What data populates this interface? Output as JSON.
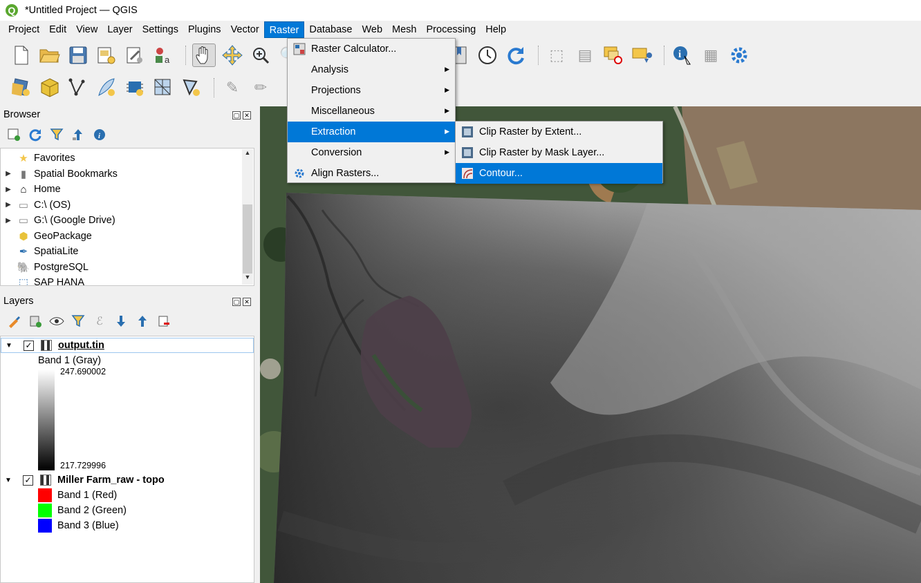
{
  "window": {
    "title": "*Untitled Project — QGIS",
    "logo_letter": "Q"
  },
  "menubar": [
    "Project",
    "Edit",
    "View",
    "Layer",
    "Settings",
    "Plugins",
    "Vector",
    "Raster",
    "Database",
    "Web",
    "Mesh",
    "Processing",
    "Help"
  ],
  "menubar_active": "Raster",
  "raster_menu": {
    "items": [
      {
        "label": "Raster Calculator...",
        "icon": "raster-calculator-icon",
        "submenu": false
      },
      {
        "label": "Analysis",
        "submenu": true
      },
      {
        "label": "Projections",
        "submenu": true
      },
      {
        "label": "Miscellaneous",
        "submenu": true
      },
      {
        "label": "Extraction",
        "submenu": true,
        "highlighted": true
      },
      {
        "label": "Conversion",
        "submenu": true
      },
      {
        "label": "Align Rasters...",
        "icon": "align-rasters-icon",
        "submenu": false
      }
    ]
  },
  "extraction_submenu": {
    "items": [
      {
        "label": "Clip Raster by Extent...",
        "icon": "clip-raster-icon"
      },
      {
        "label": "Clip Raster by Mask Layer...",
        "icon": "clip-raster-icon"
      },
      {
        "label": "Contour...",
        "icon": "contour-icon",
        "highlighted": true
      }
    ]
  },
  "browser": {
    "title": "Browser",
    "items": [
      {
        "label": "Favorites",
        "icon": "star-icon",
        "expandable": false
      },
      {
        "label": "Spatial Bookmarks",
        "icon": "bookmark-icon",
        "expandable": true
      },
      {
        "label": "Home",
        "icon": "home-icon",
        "expandable": true
      },
      {
        "label": "C:\\ (OS)",
        "icon": "drive-icon",
        "expandable": true
      },
      {
        "label": "G:\\ (Google Drive)",
        "icon": "drive-icon",
        "expandable": true
      },
      {
        "label": "GeoPackage",
        "icon": "geopackage-icon",
        "expandable": false
      },
      {
        "label": "SpatiaLite",
        "icon": "spatialite-icon",
        "expandable": false
      },
      {
        "label": "PostgreSQL",
        "icon": "postgresql-icon",
        "expandable": false
      },
      {
        "label": "SAP HANA",
        "icon": "sap-hana-icon",
        "expandable": false
      }
    ]
  },
  "layers": {
    "title": "Layers",
    "layer1": {
      "name": "output.tin",
      "checked": true,
      "band": "Band 1 (Gray)",
      "max": "247.690002",
      "min": "217.729996"
    },
    "layer2": {
      "name": "Miller Farm_raw - topo",
      "checked": true,
      "bands": [
        {
          "label": "Band 1 (Red)",
          "color": "#ff0000"
        },
        {
          "label": "Band 2 (Green)",
          "color": "#00ff00"
        },
        {
          "label": "Band 3 (Blue)",
          "color": "#0000ff"
        }
      ]
    }
  },
  "colors": {
    "accent": "#0078d7"
  }
}
